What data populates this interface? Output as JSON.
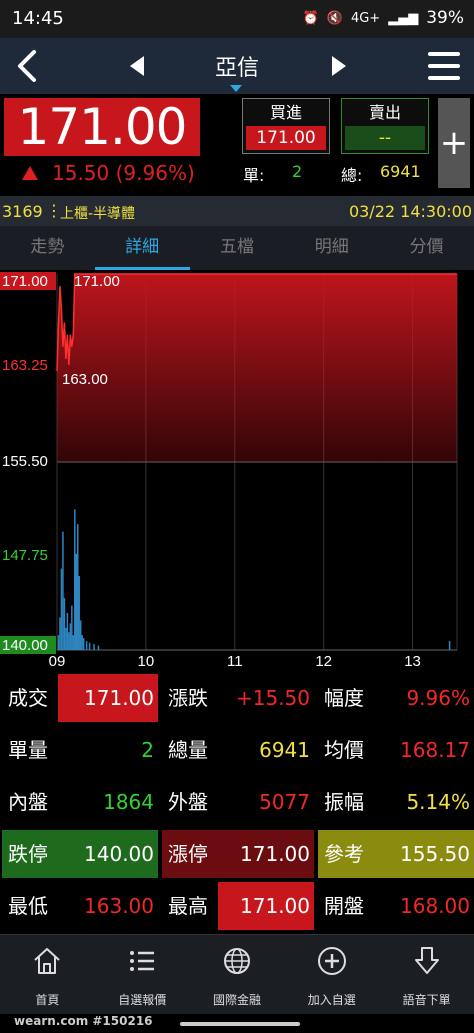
{
  "status": {
    "time": "14:45",
    "battery": "39%",
    "network": "4G+"
  },
  "nav": {
    "title": "亞信"
  },
  "quote": {
    "price": "171.00",
    "change": "15.50 (9.96%)",
    "buy_label": "買進",
    "buy_price": "171.00",
    "sell_label": "賣出",
    "sell_price": "--",
    "unit_label": "單:",
    "unit_value": "2",
    "total_label": "總:",
    "total_value": "6941",
    "plus": "+"
  },
  "info": {
    "code": "3169",
    "dots": "⋮",
    "market": "上櫃-半導體",
    "datetime": "03/22 14:30:00"
  },
  "tabs": [
    {
      "label": "走勢",
      "active": false
    },
    {
      "label": "詳細",
      "active": true
    },
    {
      "label": "五檔",
      "active": false
    },
    {
      "label": "明細",
      "active": false
    },
    {
      "label": "分價",
      "active": false
    }
  ],
  "chart_data": {
    "type": "area",
    "y_ticks": [
      "171.00",
      "163.25",
      "155.50",
      "147.75",
      "140.00"
    ],
    "ylim": [
      140.0,
      171.0
    ],
    "x_ticks": [
      "09",
      "10",
      "11",
      "12",
      "13"
    ],
    "annotations": {
      "high": "171.00",
      "low": "163.00"
    },
    "reference_price": 155.5,
    "price_series": {
      "t_minutes": [
        0,
        1,
        2,
        3,
        4,
        5,
        6,
        7,
        8,
        9,
        10,
        11,
        12,
        13,
        14,
        15,
        16,
        270
      ],
      "values": [
        163.0,
        167.0,
        170.0,
        168.0,
        165.0,
        167.0,
        164.0,
        166.0,
        163.5,
        166.0,
        165.0,
        166.0,
        171.0,
        171.0,
        171.0,
        171.0,
        171.0,
        171.0
      ]
    },
    "volume_series": {
      "t_minutes": [
        1,
        2,
        3,
        4,
        5,
        6,
        7,
        8,
        9,
        10,
        11,
        12,
        13,
        14,
        15,
        16,
        17,
        18,
        20,
        22,
        25,
        28,
        265
      ],
      "relative": [
        0.1,
        0.22,
        0.55,
        0.8,
        0.35,
        0.15,
        0.25,
        0.12,
        0.18,
        0.3,
        0.1,
        0.95,
        0.65,
        0.85,
        0.5,
        0.2,
        0.1,
        0.08,
        0.06,
        0.05,
        0.04,
        0.03,
        0.06
      ]
    },
    "colors": {
      "area": "#c8161d",
      "line": "#ff3030",
      "volume": "#2e86c1",
      "grid": "#333333"
    }
  },
  "table": {
    "rows": [
      [
        {
          "label": "成交",
          "value": "171.00",
          "color": "white",
          "bg": "#c8161d"
        },
        {
          "label": "漲跌",
          "value": "+15.50",
          "color": "red",
          "bg": ""
        },
        {
          "label": "幅度",
          "value": "9.96%",
          "color": "red",
          "bg": ""
        }
      ],
      [
        {
          "label": "單量",
          "value": "2",
          "color": "green",
          "bg": ""
        },
        {
          "label": "總量",
          "value": "6941",
          "color": "yellow",
          "bg": ""
        },
        {
          "label": "均價",
          "value": "168.17",
          "color": "red",
          "bg": ""
        }
      ],
      [
        {
          "label": "內盤",
          "value": "1864",
          "color": "green",
          "bg": ""
        },
        {
          "label": "外盤",
          "value": "5077",
          "color": "red",
          "bg": ""
        },
        {
          "label": "振幅",
          "value": "5.14%",
          "color": "yellow",
          "bg": ""
        }
      ],
      [
        {
          "label": "跌停",
          "value": "140.00",
          "color": "white",
          "bg": "#1e6b1e",
          "fullbg": true
        },
        {
          "label": "漲停",
          "value": "171.00",
          "color": "white",
          "bg": "#6b0d10",
          "fullbg": true
        },
        {
          "label": "參考",
          "value": "155.50",
          "color": "white",
          "bg": "#8b8b10",
          "fullbg": true
        }
      ],
      [
        {
          "label": "最低",
          "value": "163.00",
          "color": "red",
          "bg": ""
        },
        {
          "label": "最高",
          "value": "171.00",
          "color": "white",
          "bg": "#c8161d"
        },
        {
          "label": "開盤",
          "value": "168.00",
          "color": "red",
          "bg": ""
        }
      ]
    ]
  },
  "bottom_tabs": [
    {
      "label": "首頁",
      "icon": "home-icon"
    },
    {
      "label": "自選報價",
      "icon": "list-icon"
    },
    {
      "label": "國際金融",
      "icon": "globe-icon"
    },
    {
      "label": "加入自選",
      "icon": "add-circle-icon"
    },
    {
      "label": "語音下單",
      "icon": "download-arrow-icon"
    }
  ],
  "watermark": "wearn.com #150216"
}
